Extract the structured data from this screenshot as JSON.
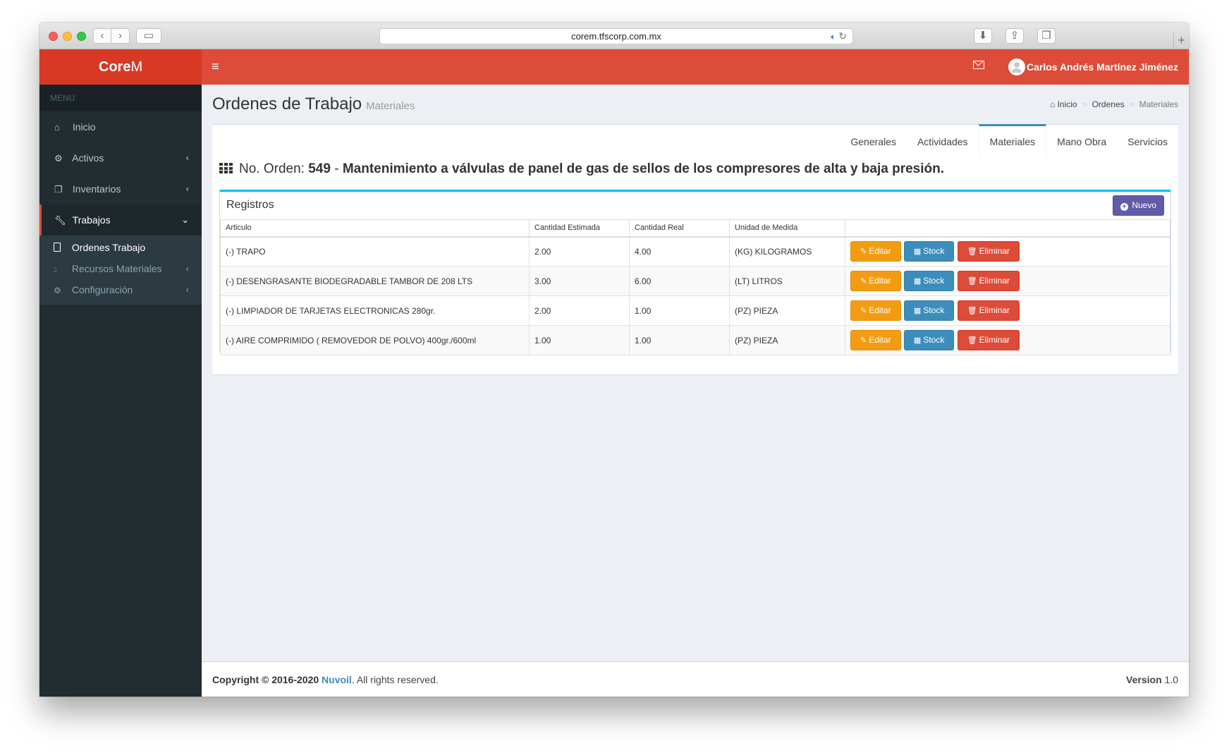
{
  "browser": {
    "url": "corem.tfscorp.com.mx",
    "plus_tab": "+"
  },
  "header": {
    "logo_bold": "Core",
    "logo_light": "M",
    "user_name": "Carlos Andrés Martínez Jiménez",
    "menu_toggle": "≡"
  },
  "sidebar": {
    "menu_header": "MENU",
    "items": [
      {
        "label": "Inicio",
        "icon": "home-icon"
      },
      {
        "label": "Activos",
        "icon": "cogs-icon"
      },
      {
        "label": "Inventarios",
        "icon": "cubes-icon"
      },
      {
        "label": "Trabajos",
        "icon": "wrench-icon"
      }
    ],
    "subitems": [
      {
        "label": "Ordenes Trabajo",
        "icon": "file-icon"
      },
      {
        "label": "Recursos Materiales",
        "icon": "drop-icon"
      },
      {
        "label": "Configuración",
        "icon": "gear-icon"
      }
    ]
  },
  "page": {
    "title": "Ordenes de Trabajo",
    "subtitle": "Materiales",
    "breadcrumb": [
      "Inicio",
      "Ordenes",
      "Materiales"
    ]
  },
  "tabs": [
    "Generales",
    "Actividades",
    "Materiales",
    "Mano Obra",
    "Servicios"
  ],
  "active_tab": "Materiales",
  "order": {
    "prefix": "No. Orden:",
    "number": "549",
    "dash": "-",
    "description": "Mantenimiento a válvulas de panel de gas de sellos de los compresores de alta y baja presión."
  },
  "registros": {
    "title": "Registros",
    "new_button": "Nuevo",
    "columns": [
      "Articulo",
      "Cantidad Estimada",
      "Cantidad Real",
      "Unidad de Medida",
      ""
    ],
    "rows": [
      {
        "articulo": "(-) TRAPO",
        "estimada": "2.00",
        "real": "4.00",
        "unidad": "(KG) KILOGRAMOS"
      },
      {
        "articulo": "(-) DESENGRASANTE BIODEGRADABLE TAMBOR DE 208 LTS",
        "estimada": "3.00",
        "real": "6.00",
        "unidad": "(LT) LITROS"
      },
      {
        "articulo": "(-) LIMPIADOR DE TARJETAS ELECTRONICAS 280gr.",
        "estimada": "2.00",
        "real": "1.00",
        "unidad": "(PZ) PIEZA"
      },
      {
        "articulo": "(-) AIRE COMPRIMIDO ( REMOVEDOR DE POLVO) 400gr./600ml",
        "estimada": "1.00",
        "real": "1.00",
        "unidad": "(PZ) PIEZA"
      }
    ],
    "actions": {
      "edit": "Editar",
      "stock": "Stock",
      "delete": "Eliminar"
    }
  },
  "footer": {
    "copyright": "Copyright © 2016-2020",
    "brand": "Nuvoil",
    "rights": ". All rights reserved.",
    "version_label": "Version",
    "version": "1.0"
  },
  "colors": {
    "header_red": "#dd4b39",
    "logo_red": "#d73925",
    "sidebar_dark": "#222d32",
    "accent_blue": "#3c8dbc",
    "edit_orange": "#f39c12",
    "delete_red": "#dd4b39",
    "new_purple": "#605ca8",
    "box_top_cyan": "#00c0ef"
  }
}
